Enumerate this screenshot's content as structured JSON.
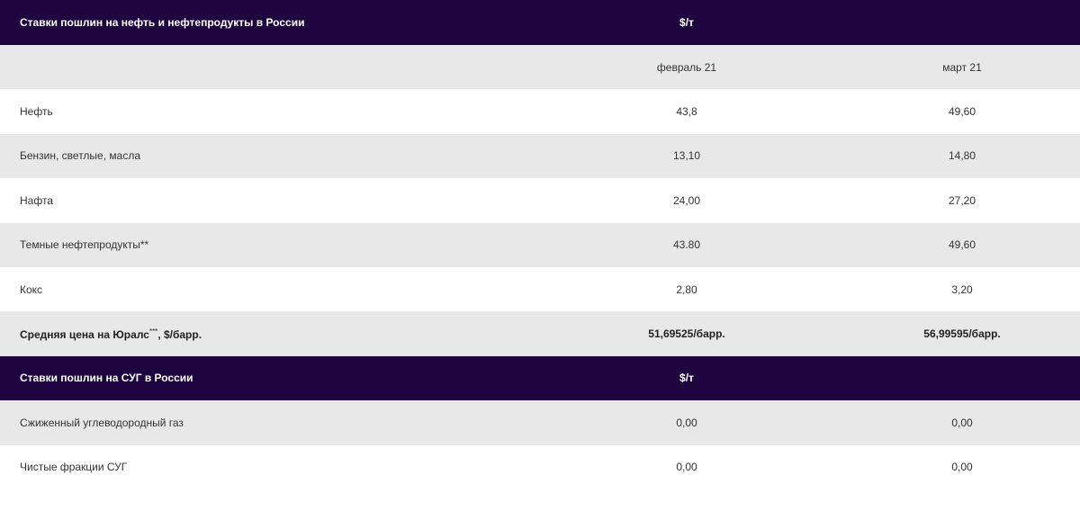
{
  "oil_table": {
    "title": "Ставки пошлин на нефть и нефтепродукты в России",
    "unit": "$/т",
    "columns": [
      "февраль 21",
      "март 21"
    ],
    "rows": [
      {
        "label": "Нефть",
        "feb": "43,8",
        "mar": "49,60"
      },
      {
        "label": "Бензин, светлые, масла",
        "feb": "13,10",
        "mar": "14,80"
      },
      {
        "label": "Нафта",
        "feb": "24,00",
        "mar": "27,20"
      },
      {
        "label": "Темные нефтепродукты**",
        "feb": "43.80",
        "mar": "49,60"
      },
      {
        "label": "Кокс",
        "feb": "2,80",
        "mar": "3,20"
      }
    ],
    "urals": {
      "label_prefix": "Средняя цена на Юралс",
      "label_sup": "***",
      "label_suffix": ", $/барр.",
      "feb": "51,69525/барр.",
      "mar": "56,99595/барр."
    }
  },
  "lpg_table": {
    "title": "Ставки пошлин на СУГ в России",
    "unit": "$/т",
    "rows": [
      {
        "label": "Сжиженный углеводородный газ",
        "feb": "0,00",
        "mar": "0,00"
      },
      {
        "label": "Чистые фракции СУГ",
        "feb": "0,00",
        "mar": "0,00"
      }
    ]
  }
}
